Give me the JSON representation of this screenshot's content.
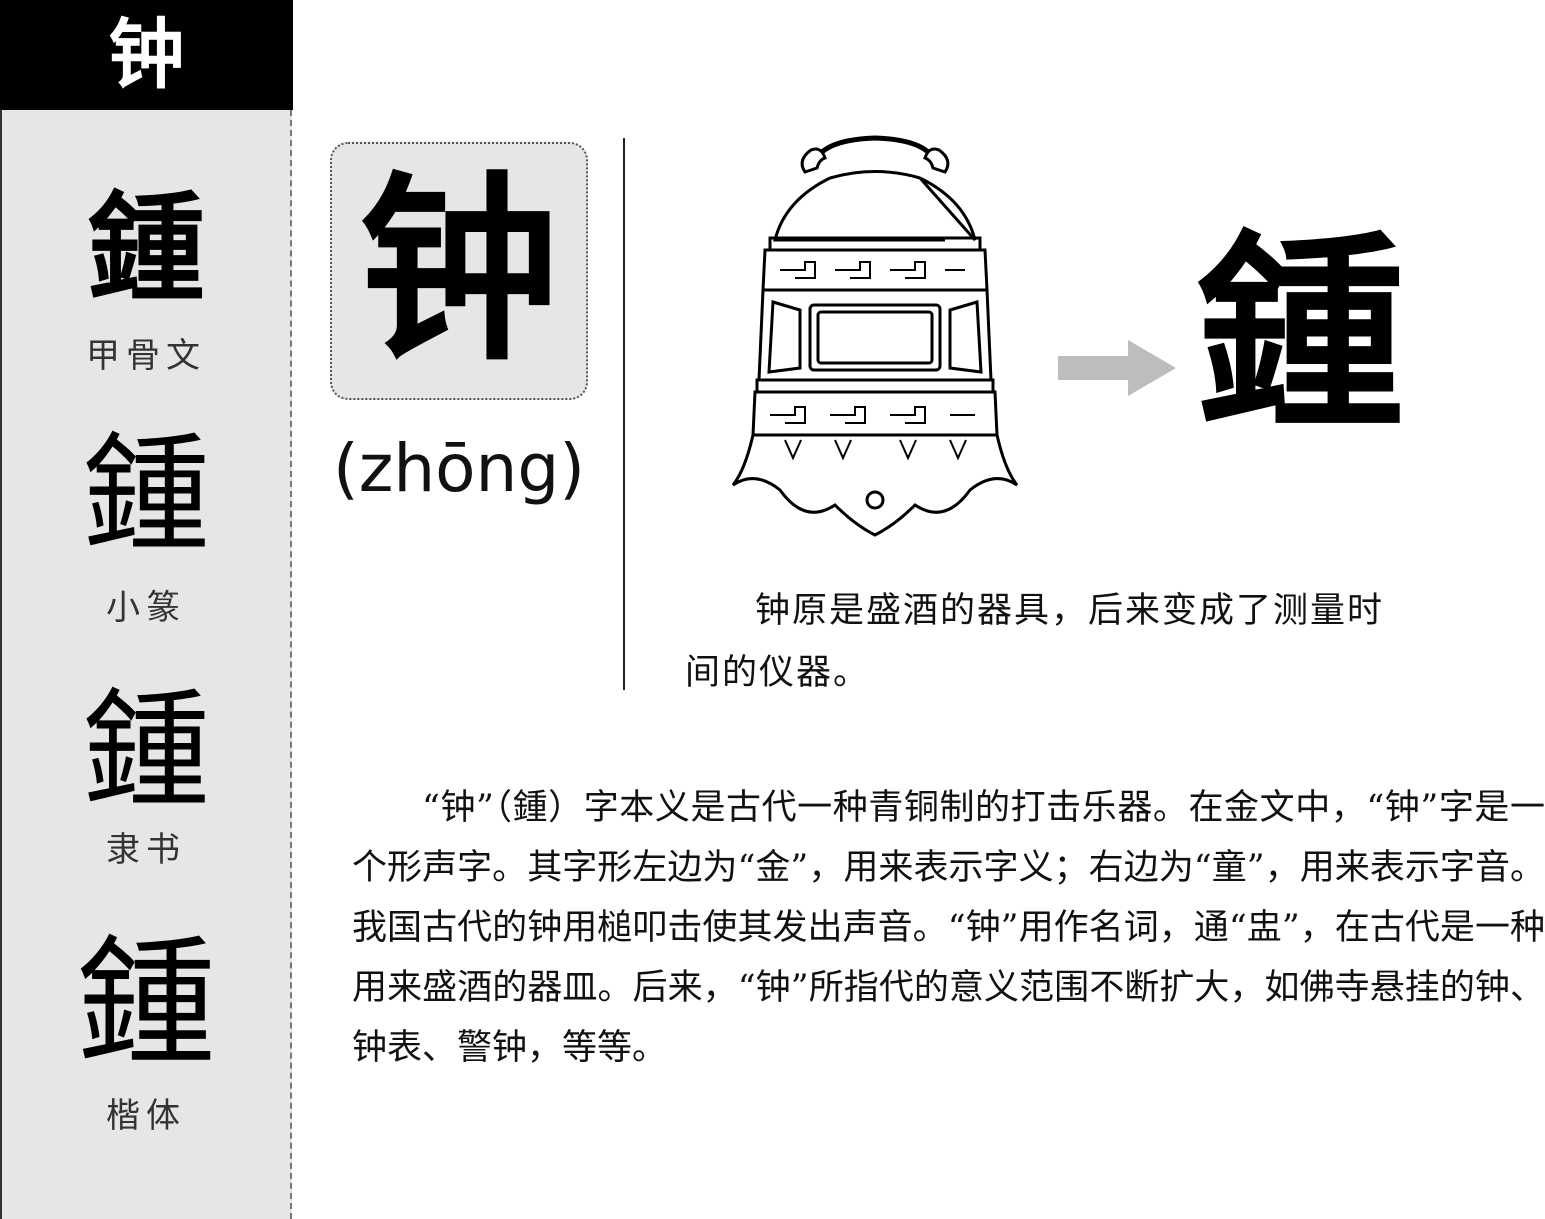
{
  "header": {
    "character": "钟"
  },
  "sidebar": {
    "scripts": [
      {
        "glyph": "鍾",
        "label": "甲骨文"
      },
      {
        "glyph": "鍾",
        "label": "小篆"
      },
      {
        "glyph": "鍾",
        "label": "隶书"
      },
      {
        "glyph": "鍾",
        "label": "楷体"
      }
    ]
  },
  "main": {
    "character": "钟",
    "pinyin": "(zhōng)",
    "bronze_glyph": "鍾",
    "caption": "钟原是盛酒的器具，后来变成了测量时间的仪器。",
    "body": "“钟”（鍾）字本义是古代一种青铜制的打击乐器。在金文中，“钟”字是一个形声字。其字形左边为“金”，用来表示字义；右边为“童”，用来表示字音。我国古代的钟用槌叩击使其发出声音。“钟”用作名词，通“盅”，在古代是一种用来盛酒的器皿。后来，“钟”所指代的意义范围不断扩大，如佛寺悬挂的钟、钟表、警钟，等等。"
  },
  "illustration": {
    "subject": "bell-icon",
    "arrow": "right-arrow-icon",
    "arrow_color": "#bdbdbd"
  }
}
